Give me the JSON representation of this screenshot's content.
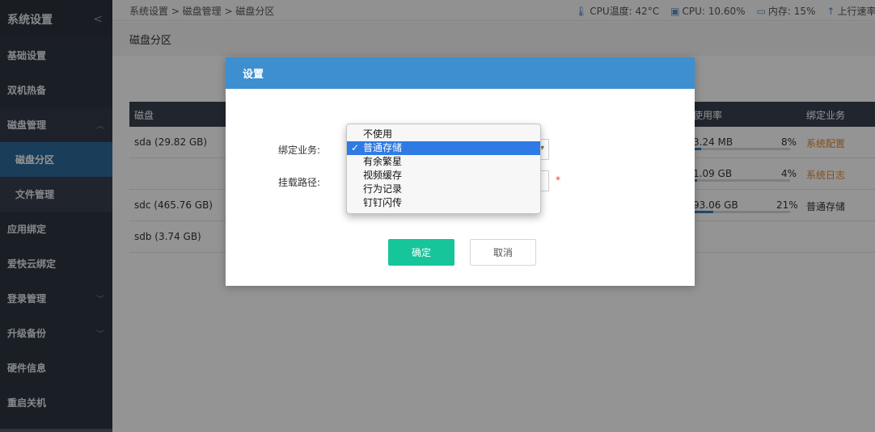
{
  "sidebar": {
    "title": "系统设置",
    "collapse_icon": "chevron-left-icon",
    "items": [
      {
        "label": "基础设置"
      },
      {
        "label": "双机热备"
      },
      {
        "label": "磁盘管理"
      },
      {
        "label": "应用绑定"
      },
      {
        "label": "爱快云绑定"
      },
      {
        "label": "登录管理"
      },
      {
        "label": "升级备份"
      },
      {
        "label": "硬件信息"
      },
      {
        "label": "重启关机"
      }
    ],
    "subitems": [
      {
        "label": "磁盘分区"
      },
      {
        "label": "文件管理"
      }
    ]
  },
  "topbar": {
    "breadcrumb": "系统设置 > 磁盘管理 > 磁盘分区",
    "cpu_temp": "CPU温度: 42°C",
    "cpu_usage": "CPU: 10.60%",
    "memory": "内存: 15%",
    "upload": "上行速率"
  },
  "page": {
    "title": "磁盘分区"
  },
  "table": {
    "headers": {
      "disk": "磁盘",
      "usage": "使用率",
      "binding": "绑定业务"
    },
    "rows": [
      {
        "disk": "sda (29.82 GB)",
        "used": "3.24 MB",
        "percent": "8%",
        "percent_value": 8,
        "binding": "系统配置"
      },
      {
        "disk": "",
        "used": "1.09 GB",
        "percent": "4%",
        "percent_value": 4,
        "binding": "系统日志"
      },
      {
        "disk": "sdc (465.76 GB)",
        "used": "93.06 GB",
        "percent": "21%",
        "percent_value": 21,
        "binding": "普通存储"
      },
      {
        "disk": "sdb (3.74 GB)",
        "used": "",
        "percent": "",
        "percent_value": null,
        "binding": ""
      }
    ]
  },
  "modal": {
    "title": "设置",
    "bind_label": "绑定业务:",
    "path_label": "挂载路径:",
    "required_mark": "*",
    "ok_label": "确定",
    "cancel_label": "取消"
  },
  "dropdown": {
    "options": [
      "不使用",
      "普通存储",
      "有余繁星",
      "视频缓存",
      "行为记录",
      "钉钉闪传"
    ],
    "selected": "普通存储",
    "check_mark": "✓"
  },
  "colors": {
    "sidebar_bg": "#2e3642",
    "active_item": "#2e6a9c",
    "modal_header": "#3d8fd0",
    "ok_button": "#17c59a",
    "dropdown_selected": "#2f7ae5",
    "binding_orange": "#e08a2c"
  }
}
